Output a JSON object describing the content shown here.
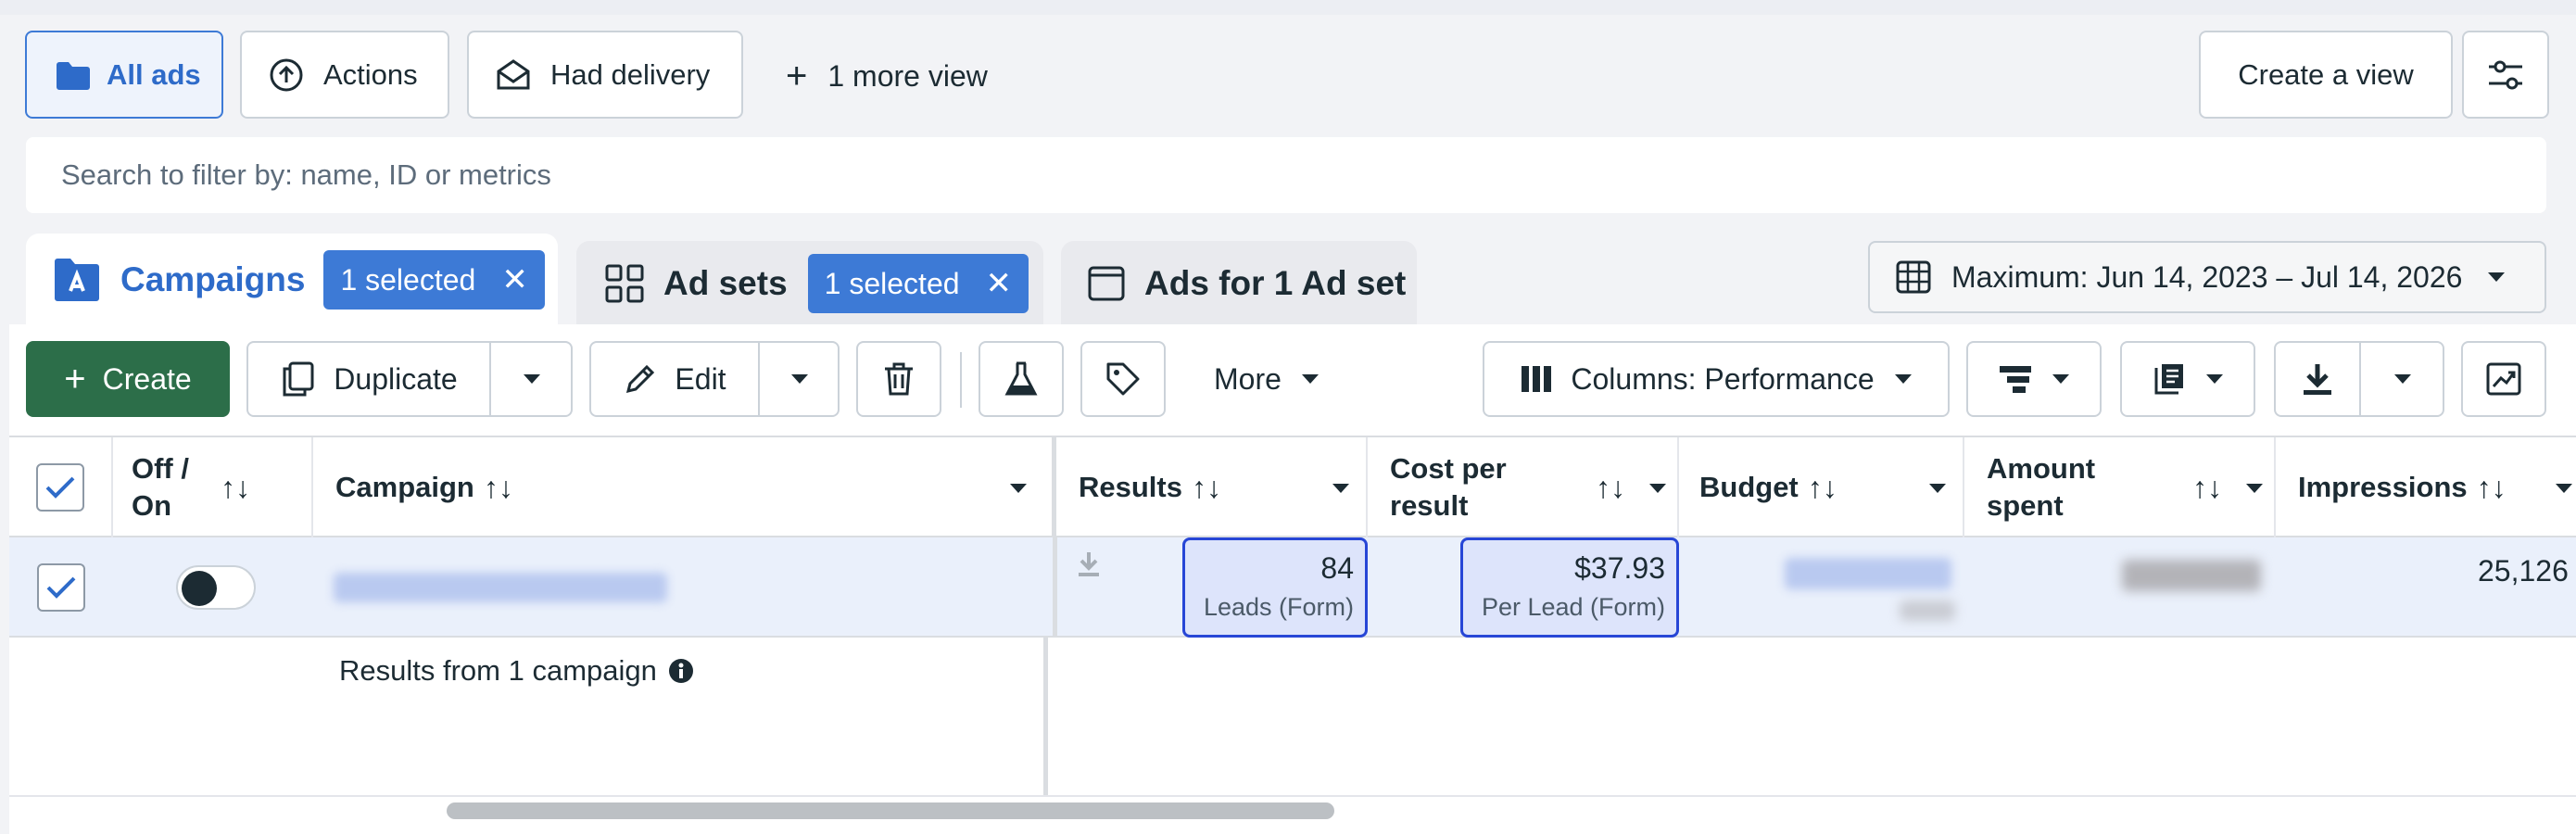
{
  "views": {
    "all_ads": "All ads",
    "actions": "Actions",
    "had_delivery": "Had delivery",
    "more_view": "1 more view",
    "create_view": "Create a view"
  },
  "search": {
    "placeholder": "Search to filter by: name, ID or metrics"
  },
  "level_tabs": {
    "campaigns": "Campaigns",
    "campaigns_badge": "1 selected",
    "ad_sets": "Ad sets",
    "ad_sets_badge": "1 selected",
    "ads": "Ads for 1 Ad set",
    "close_glyph": "✕"
  },
  "date_range": "Maximum: Jun 14, 2023 – Jul 14, 2026",
  "toolbar": {
    "create": "Create",
    "duplicate": "Duplicate",
    "edit": "Edit",
    "more": "More",
    "columns": "Columns: Performance"
  },
  "table": {
    "headers": {
      "off_on": "Off /\nOn",
      "campaign": "Campaign",
      "results": "Results",
      "cost_per_result": "Cost per\nresult",
      "budget": "Budget",
      "amount_spent": "Amount\nspent",
      "impressions": "Impressions"
    },
    "sort_glyph": "↑↓",
    "row": {
      "results_value": "84",
      "results_sub": "Leads (Form)",
      "cpr_value": "$37.93",
      "cpr_sub": "Per Lead (Form)",
      "impressions_value": "25,126"
    },
    "footer": "Results from 1 campaign"
  },
  "colors": {
    "accent": "#3d7ad6",
    "create_green": "#2c6e49",
    "highlight_border": "#2746d6"
  }
}
